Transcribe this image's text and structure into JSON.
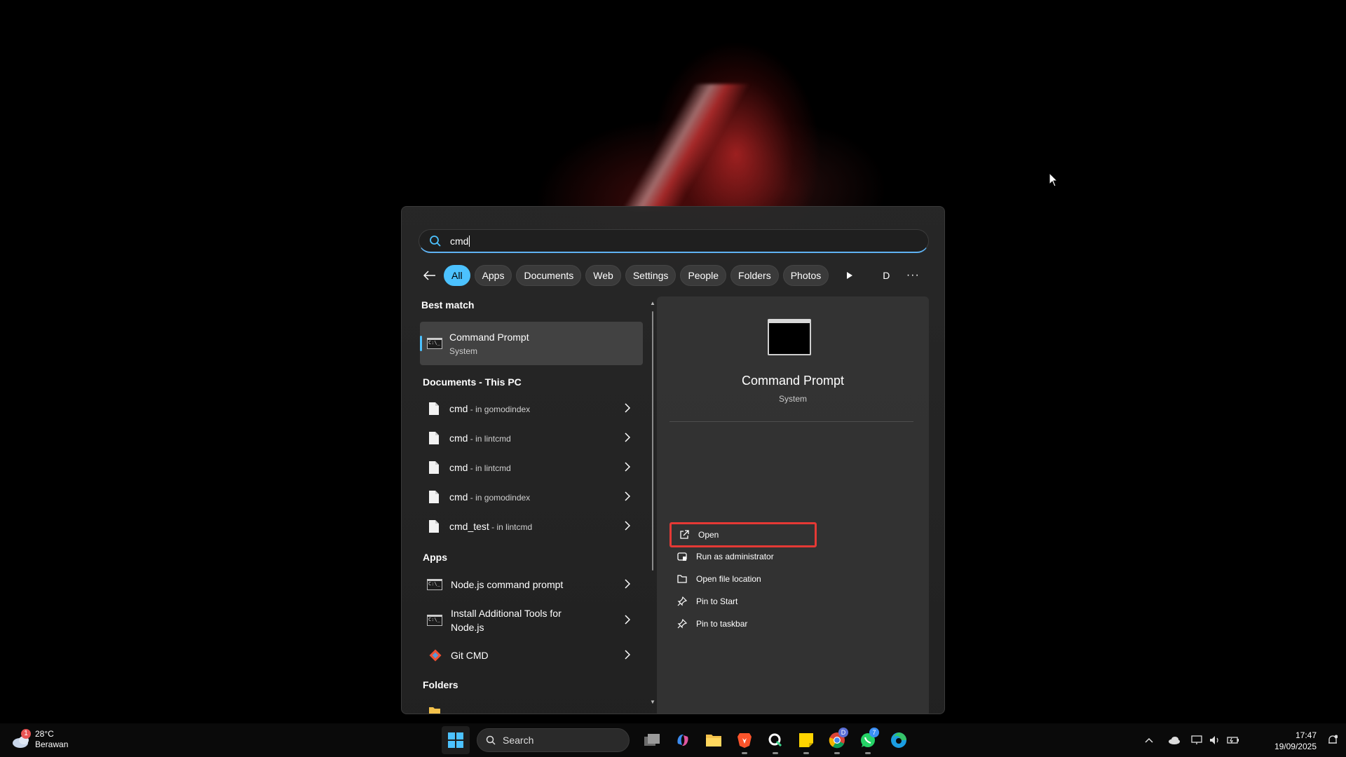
{
  "search": {
    "query": "cmd"
  },
  "filters": {
    "chips": [
      "All",
      "Apps",
      "Documents",
      "Web",
      "Settings",
      "People",
      "Folders",
      "Photos"
    ],
    "avatar_letter": "D",
    "more": "···"
  },
  "results": {
    "best_match_title": "Best match",
    "best_match": {
      "name": "Command Prompt",
      "type": "System"
    },
    "documents_title": "Documents - This PC",
    "documents": [
      {
        "name": "cmd",
        "location": " - in gomodindex"
      },
      {
        "name": "cmd",
        "location": " - in lintcmd"
      },
      {
        "name": "cmd",
        "location": " - in lintcmd"
      },
      {
        "name": "cmd",
        "location": " - in gomodindex"
      },
      {
        "name": "cmd_test",
        "location": " - in lintcmd"
      }
    ],
    "apps_title": "Apps",
    "apps": [
      {
        "name": "Node.js command prompt",
        "icon": "cmd-icon"
      },
      {
        "name": "Install Additional Tools for Node.js",
        "icon": "cmd-icon"
      },
      {
        "name": "Git CMD",
        "icon": "git-icon"
      }
    ],
    "folders_title": "Folders"
  },
  "detail": {
    "title": "Command Prompt",
    "subtitle": "System",
    "actions": [
      {
        "label": "Open",
        "icon": "open-external-icon"
      },
      {
        "label": "Run as administrator",
        "icon": "shield-admin-icon"
      },
      {
        "label": "Open file location",
        "icon": "folder-icon"
      },
      {
        "label": "Pin to Start",
        "icon": "pin-icon"
      },
      {
        "label": "Pin to taskbar",
        "icon": "pin-icon"
      }
    ]
  },
  "taskbar": {
    "weather": {
      "temp": "28°C",
      "condition": "Berawan",
      "badge": "1"
    },
    "search_label": "Search",
    "apps": [
      "task-view",
      "copilot",
      "file-explorer",
      "brave",
      "app-q",
      "sticky-notes",
      "chrome",
      "whatsapp",
      "edge"
    ],
    "chrome_badge": "D",
    "whatsapp_badge": "7",
    "time": "17:47",
    "date": "19/09/2025"
  },
  "colors": {
    "accent": "#4cc2ff",
    "highlight_border": "#e53935"
  }
}
